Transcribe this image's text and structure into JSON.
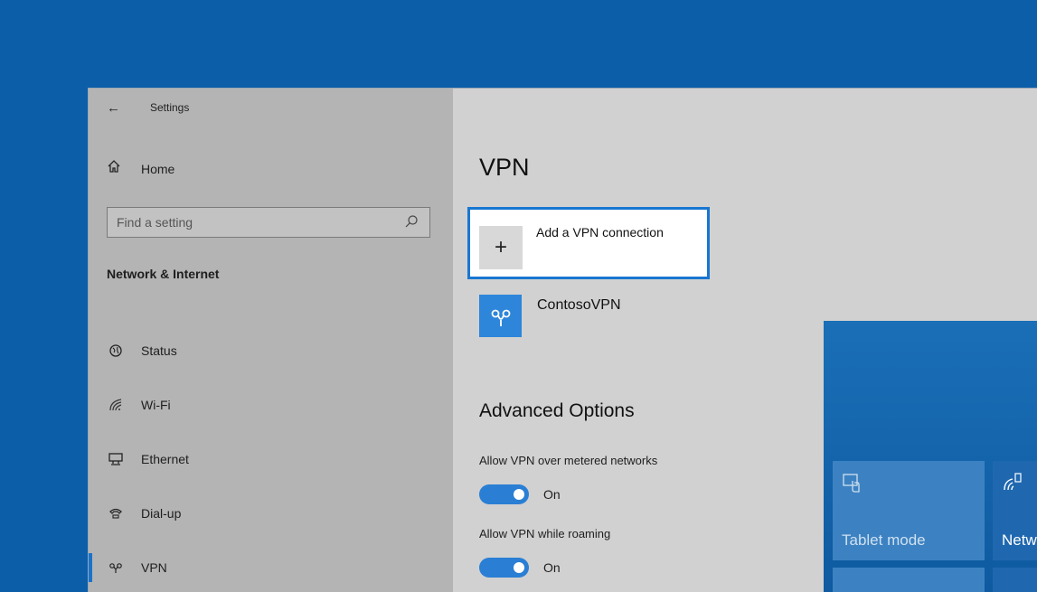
{
  "window": {
    "back_icon": "arrow-left-icon",
    "title": "Settings"
  },
  "sidebar": {
    "home_label": "Home",
    "home_icon": "home-icon",
    "search": {
      "placeholder": "Find a setting",
      "icon": "search-icon"
    },
    "section_title": "Network & Internet",
    "items": [
      {
        "label": "Status",
        "icon": "globe-icon"
      },
      {
        "label": "Wi-Fi",
        "icon": "wifi-icon"
      },
      {
        "label": "Ethernet",
        "icon": "ethernet-icon"
      },
      {
        "label": "Dial-up",
        "icon": "dialup-icon"
      },
      {
        "label": "VPN",
        "icon": "vpn-icon",
        "active": true
      }
    ]
  },
  "main": {
    "title": "VPN",
    "add_vpn": {
      "plus": "+",
      "label": "Add a VPN connection"
    },
    "connection": {
      "label": "ContosoVPN",
      "icon": "vpn-icon"
    },
    "advanced_title": "Advanced Options",
    "options": [
      {
        "label": "Allow VPN over metered networks",
        "state": "On"
      },
      {
        "label": "Allow VPN while roaming",
        "state": "On"
      }
    ],
    "accent": "#2a7fd4"
  },
  "action_center": {
    "tiles": [
      {
        "label": "Tablet mode",
        "icon": "tablet-mode-icon"
      },
      {
        "label": "Netw",
        "icon": "network-icon"
      }
    ]
  }
}
